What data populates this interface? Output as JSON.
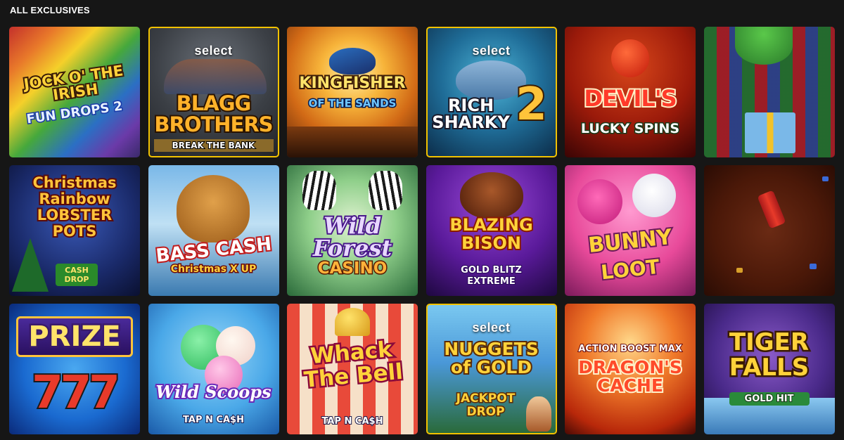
{
  "section": {
    "title": "ALL EXCLUSIVES"
  },
  "tiles": [
    {
      "title": "JOCK O' THE IRISH",
      "sub": "FUN DROPS 2"
    },
    {
      "badge": "select",
      "title": "BLAGG BROTHERS",
      "sub": "BREAK THE BANK"
    },
    {
      "title": "KINGFISHER",
      "sub": "OF THE SANDS"
    },
    {
      "badge": "select",
      "title": "RICH SHARKY",
      "sub": "2"
    },
    {
      "title": "DEVIL'S",
      "sub": "LUCKY SPINS"
    },
    {
      "title": ""
    },
    {
      "title": "Christmas Rainbow LOBSTER POTS",
      "sub": "CASH DROP"
    },
    {
      "title": "BASS CASH",
      "sub": "Christmas X UP"
    },
    {
      "title": "Wild Forest",
      "sub": "CASINO"
    },
    {
      "title": "BLAZING BISON",
      "sub": "GOLD BLITZ EXTREME"
    },
    {
      "title": "BUNNY",
      "sub": "LOOT"
    },
    {
      "title": ""
    },
    {
      "title": "PRIZE",
      "sub": "777"
    },
    {
      "title": "Wild Scoops",
      "sub": "TAP N CA$H"
    },
    {
      "title": "Whack The Bell",
      "sub": "TAP N CA$H"
    },
    {
      "badge": "select",
      "title": "NUGGETS of GOLD",
      "sub": "JACKPOT DROP"
    },
    {
      "title": "ACTION BOOST MAX",
      "sub": "DRAGON'S CACHE"
    },
    {
      "title": "TIGER FALLS",
      "sub": "GOLD HIT"
    }
  ]
}
